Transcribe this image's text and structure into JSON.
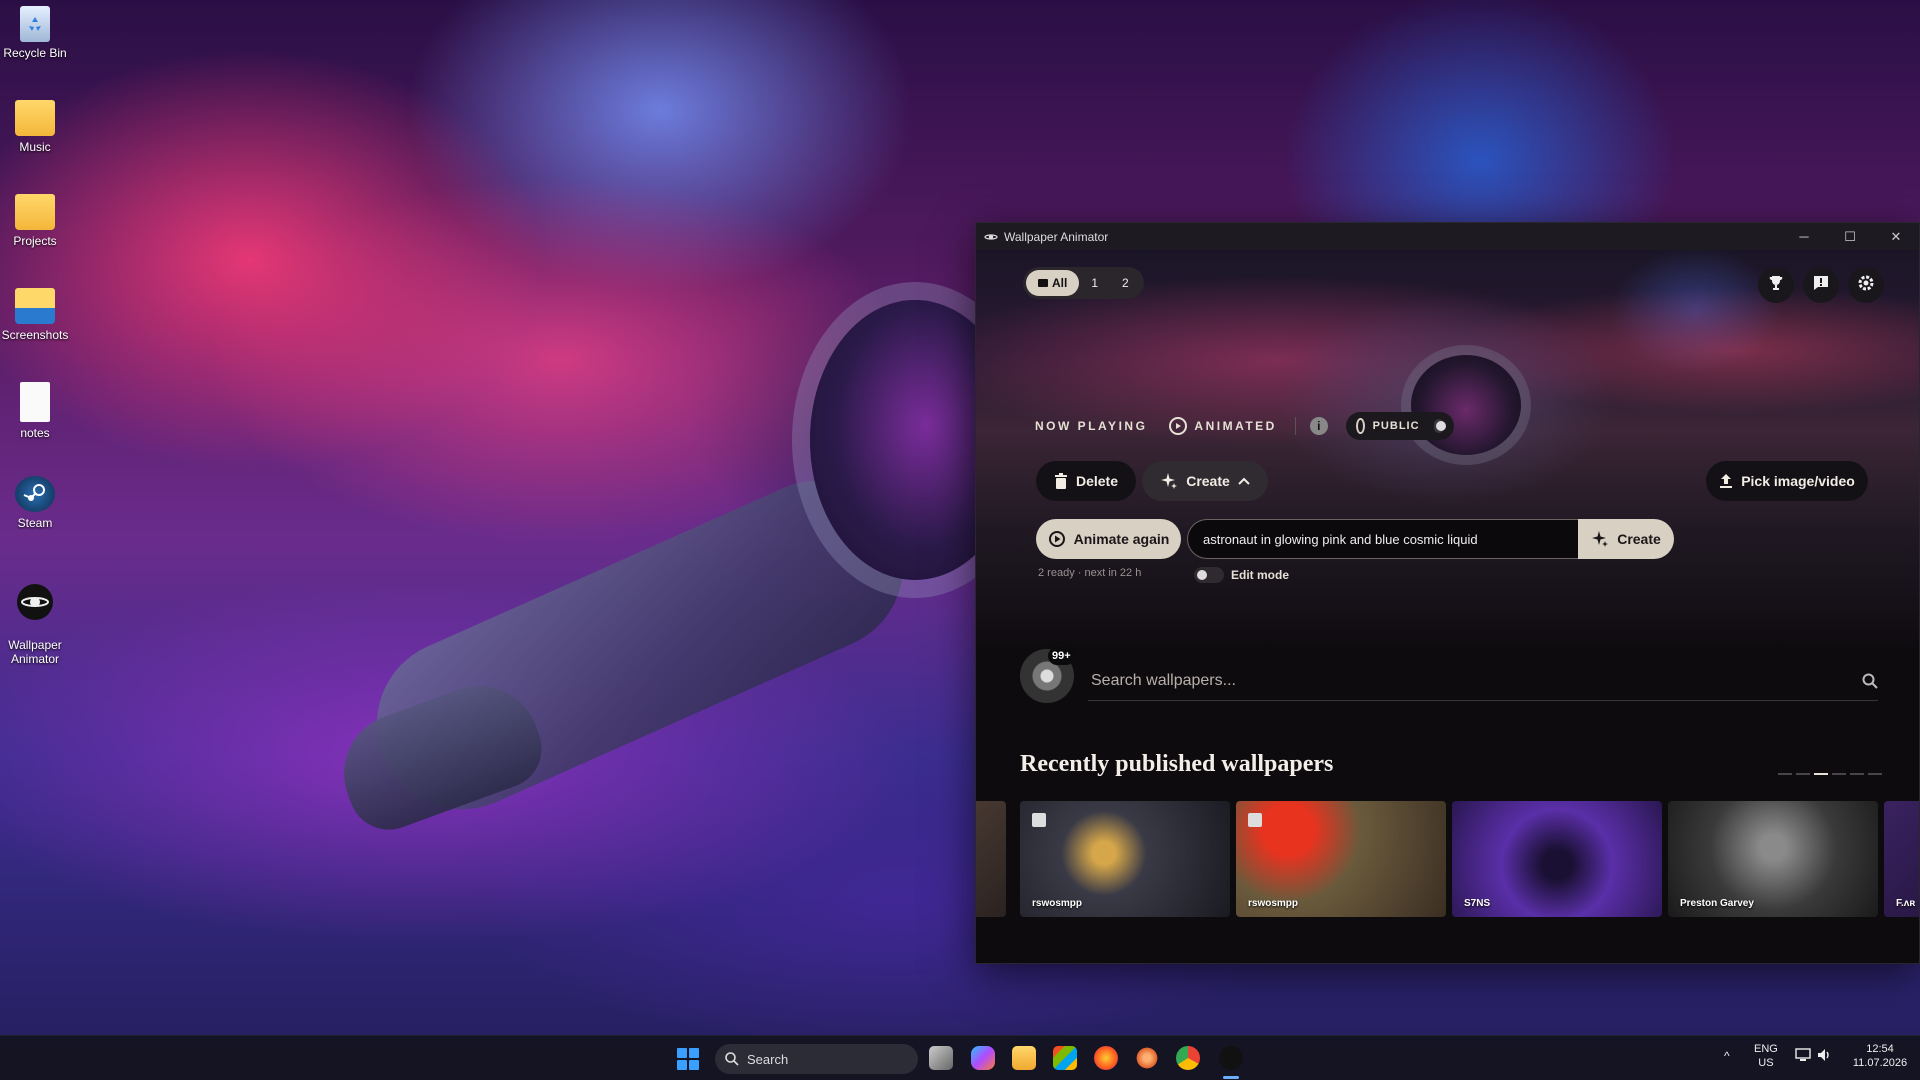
{
  "desktop": {
    "icons": [
      {
        "label": "Recycle Bin",
        "icon": "recycle-bin-icon"
      },
      {
        "label": "Music",
        "icon": "folder-icon"
      },
      {
        "label": "Projects",
        "icon": "folder-icon"
      },
      {
        "label": "Screenshots",
        "icon": "folder-icon"
      },
      {
        "label": "notes",
        "icon": "text-file-icon"
      },
      {
        "label": "Steam",
        "icon": "steam-icon"
      },
      {
        "label": "Wallpaper\nAnimator",
        "icon": "wallpaper-animator-icon"
      }
    ]
  },
  "window": {
    "title": "Wallpaper Animator",
    "controls": {
      "minimize": "─",
      "maximize": "☐",
      "close": "✕"
    }
  },
  "monitor_selector": {
    "options": [
      "All",
      "1",
      "2"
    ],
    "selected": "All"
  },
  "now_playing": {
    "label": "NOW PLAYING",
    "mode": "ANIMATED",
    "visibility_label": "PUBLIC",
    "public_enabled": false
  },
  "actions": {
    "delete_label": "Delete",
    "create_label": "Create",
    "pick_label": "Pick image/video",
    "animate_again_label": "Animate again",
    "prompt_value": "astronaut in glowing pink and blue cosmic liquid",
    "prompt_create_label": "Create",
    "ready_status": "2 ready · next in 22 h",
    "edit_mode_label": "Edit mode",
    "edit_mode_enabled": false
  },
  "profile": {
    "badge": "99+"
  },
  "search": {
    "placeholder": "Search wallpapers..."
  },
  "recent": {
    "title": "Recently published wallpapers",
    "pages": 6,
    "current_page": 3,
    "items": [
      {
        "author": ""
      },
      {
        "author": "rswosmpp"
      },
      {
        "author": "rswosmpp"
      },
      {
        "author": "S7NS"
      },
      {
        "author": "Preston Garvey"
      },
      {
        "author": "F.ʌʀ"
      }
    ]
  },
  "taskbar": {
    "search_label": "Search",
    "language_top": "ENG",
    "language_bottom": "US",
    "time": "12:54",
    "date": "11.07.2026"
  },
  "colors": {
    "accent_beige": "#d9d0c4",
    "window_bg": "#0e0b0f",
    "taskbar_accent": "#6ab0ff"
  }
}
